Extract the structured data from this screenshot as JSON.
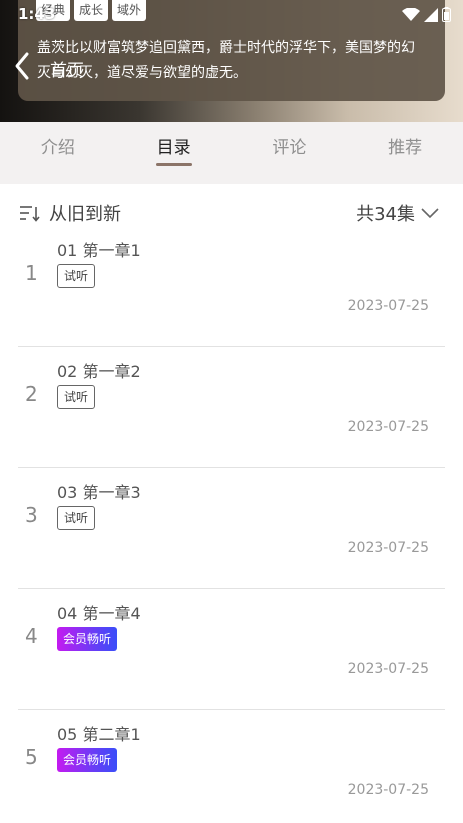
{
  "status_bar": {
    "time": "1:43"
  },
  "hero": {
    "tags": [
      "经典",
      "成长",
      "域外"
    ],
    "synopsis": "盖茨比以财富筑梦追回黛西，爵士时代的浮华下，美国梦的幻灭与幻灭，道尽爱与欲望的虚无。",
    "title": "首页"
  },
  "tabs": [
    {
      "label": "介绍",
      "active": false
    },
    {
      "label": "目录",
      "active": true
    },
    {
      "label": "评论",
      "active": false
    },
    {
      "label": "推荐",
      "active": false
    }
  ],
  "sort": {
    "label": "从旧到新",
    "count_label": "共34集"
  },
  "episodes": [
    {
      "index": "1",
      "title": "01 第一章1",
      "badge": "试听",
      "badge_type": "trial",
      "date": "2023-07-25"
    },
    {
      "index": "2",
      "title": "02 第一章2",
      "badge": "试听",
      "badge_type": "trial",
      "date": "2023-07-25"
    },
    {
      "index": "3",
      "title": "03 第一章3",
      "badge": "试听",
      "badge_type": "trial",
      "date": "2023-07-25"
    },
    {
      "index": "4",
      "title": "04 第一章4",
      "badge": "会员畅听",
      "badge_type": "vip",
      "date": "2023-07-25"
    },
    {
      "index": "5",
      "title": "05 第二章1",
      "badge": "会员畅听",
      "badge_type": "vip",
      "date": "2023-07-25"
    }
  ],
  "colors": {
    "tab_indicator": "#8b7468",
    "vip_gradient_start": "#c41bf0",
    "vip_gradient_end": "#3a4ef8"
  },
  "icons": {
    "back": "chevron-left-icon",
    "sort": "sort-ascending-icon",
    "expand": "chevron-down-icon",
    "wifi": "wifi-icon",
    "signal": "signal-icon",
    "battery": "battery-icon"
  }
}
